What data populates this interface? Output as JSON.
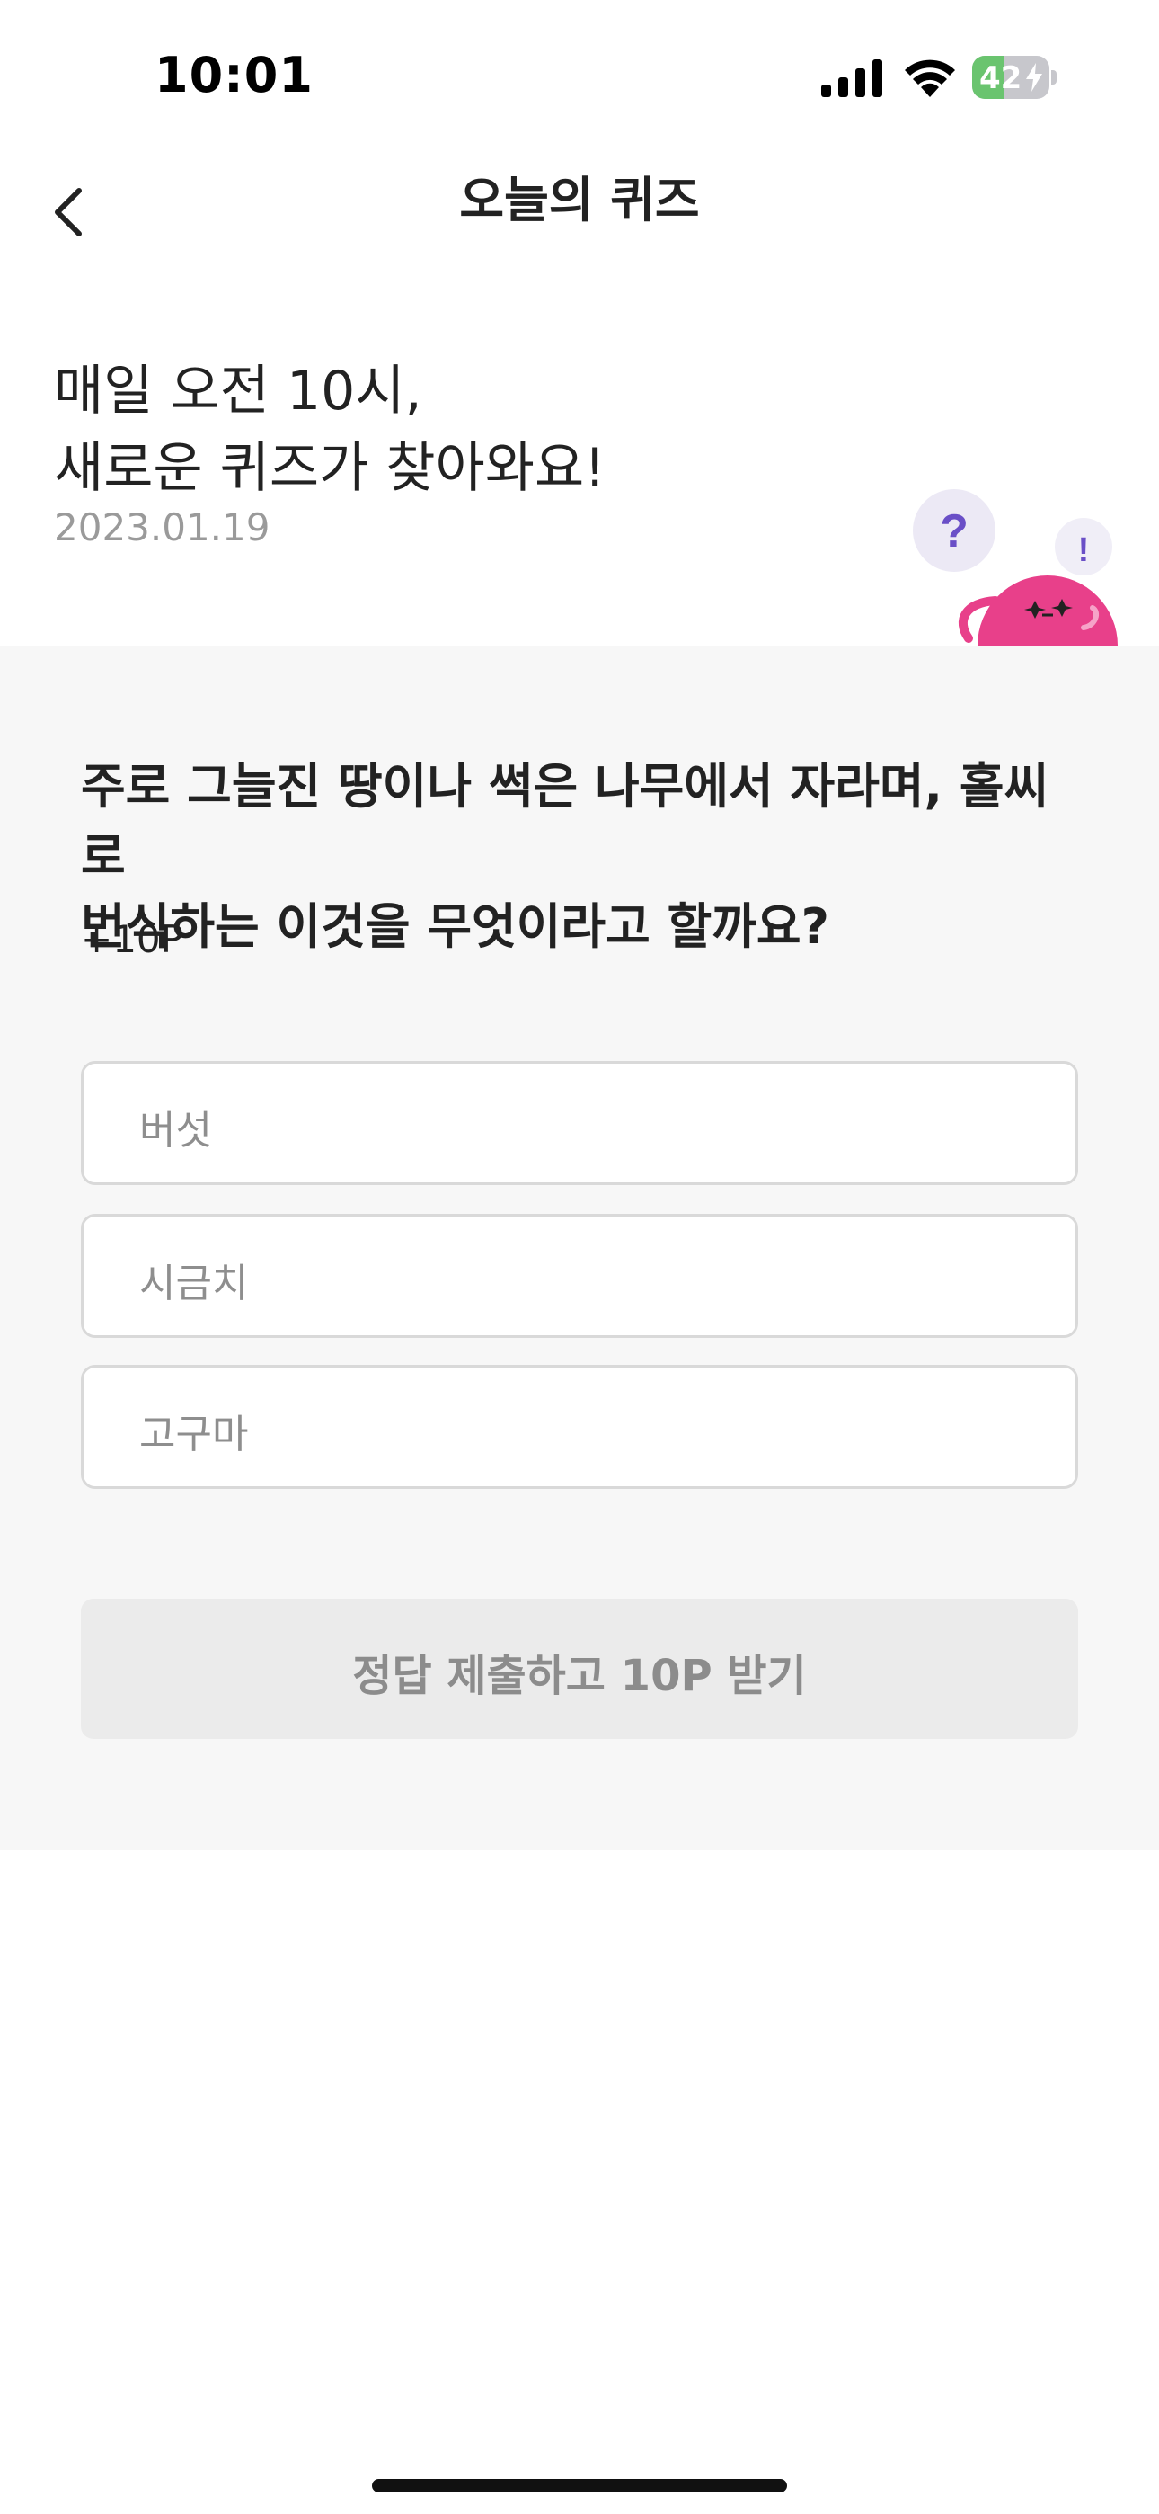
{
  "status_bar": {
    "time": "10:01",
    "battery_level": "42",
    "battery_fraction": 0.42,
    "icons": [
      "signal-icon",
      "wifi-icon",
      "battery-icon"
    ]
  },
  "nav": {
    "title": "오늘의 퀴즈",
    "back_icon": "chevron-left-icon"
  },
  "intro": {
    "headline_line1": "매일 오전 10시,",
    "headline_line2": "새로운 퀴즈가 찾아와요!",
    "date": "2023.01.19",
    "mascot_marks": [
      "?",
      "!"
    ]
  },
  "quiz": {
    "question_line1": "주로 그늘진 땅이나 썩은 나무에서 자라며, 홀씨로",
    "question_line2": "번식하는 이것을 무엇이라고 할까요?",
    "reward": "+10P",
    "options": [
      {
        "label": "버섯"
      },
      {
        "label": "시금치"
      },
      {
        "label": "고구마"
      }
    ],
    "submit_label": "정답 제출하고 10P 받기"
  },
  "colors": {
    "accent_pink": "#e8408a",
    "mascot_bubble": "#ece9f5",
    "mascot_mark": "#6a4fc7",
    "section_bg": "#f7f7f7",
    "button_disabled": "#ebebeb",
    "battery_green": "#6ac46f"
  }
}
